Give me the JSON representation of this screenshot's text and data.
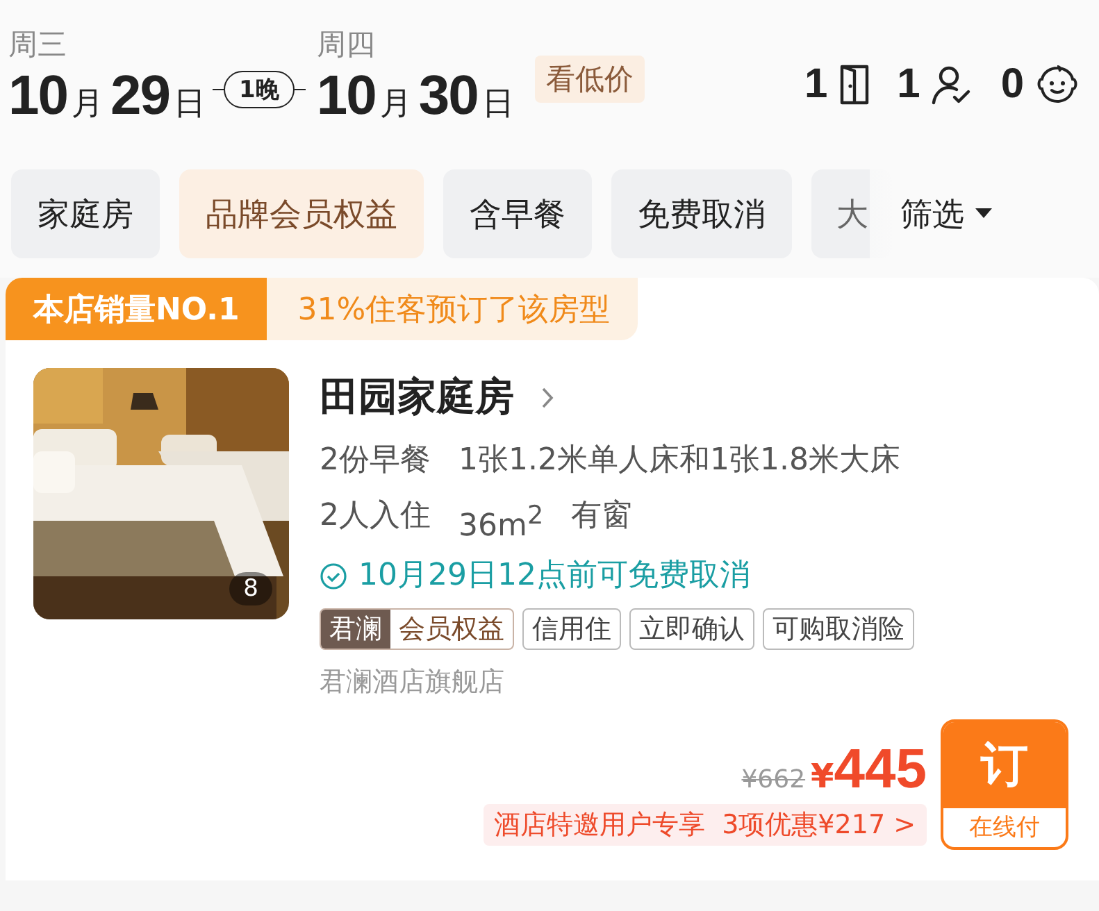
{
  "stay": {
    "checkin": {
      "weekday": "周三",
      "parts": [
        {
          "text": "10",
          "kind": "number"
        },
        {
          "text": "月",
          "kind": "unit"
        },
        {
          "text": "29",
          "kind": "number"
        },
        {
          "text": "日",
          "kind": "unit"
        }
      ]
    },
    "nights": "1晚",
    "checkout": {
      "weekday": "周四",
      "parts": [
        {
          "text": "10",
          "kind": "number"
        },
        {
          "text": "月",
          "kind": "unit"
        },
        {
          "text": "30",
          "kind": "number"
        },
        {
          "text": "日",
          "kind": "unit"
        }
      ]
    },
    "low_price_tag": "看低价",
    "counts": [
      {
        "count": "1",
        "kind": "room"
      },
      {
        "count": "1",
        "kind": "adult"
      },
      {
        "count": "0",
        "kind": "child"
      }
    ]
  },
  "filters": [
    {
      "label": "家庭房",
      "selected": false
    },
    {
      "label": "品牌会员权益",
      "selected": true
    },
    {
      "label": "含早餐",
      "selected": false
    },
    {
      "label": "免费取消",
      "selected": false
    },
    {
      "label": "大",
      "selected": false
    }
  ],
  "filter_menu": "筛选",
  "room": {
    "badge": "本店销量NO.1",
    "booking_note": "31%住客预订了该房型",
    "photo_count": "8",
    "name": "田园家庭房",
    "details": [
      [
        "2份早餐",
        "1张1.2米单人床和1张1.8米大床"
      ],
      [
        "2人入住",
        "36m$^{2}$",
        "有窗"
      ]
    ],
    "cancellation": "10月29日12点前可免费取消",
    "brand_tag": {
      "brand": "君澜",
      "label": "会员权益"
    },
    "tags": [
      "信用住",
      "立即确认",
      "可购取消险"
    ],
    "shop": "君澜酒店旗舰店",
    "original_price": "¥662",
    "currency": "¥",
    "price": "445",
    "promo": {
      "label": "酒店特邀用户专享",
      "detail": "3项优惠¥217 >"
    },
    "book_button": {
      "label": "订",
      "payment": "在线付"
    }
  }
}
